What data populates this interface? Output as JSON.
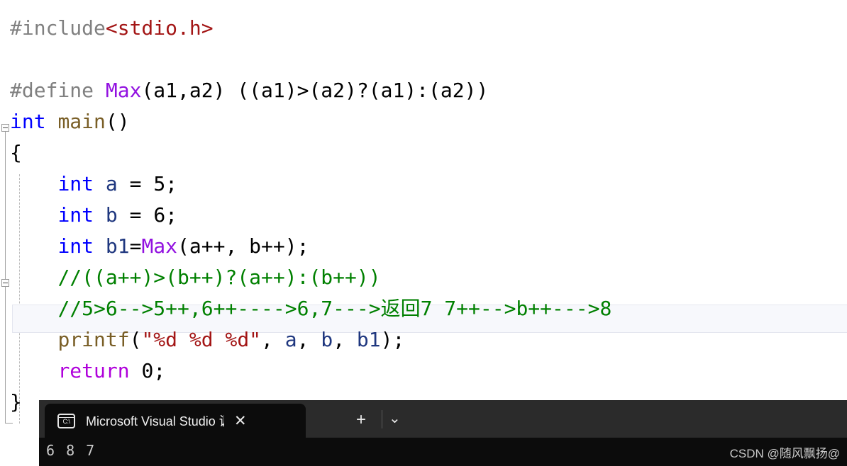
{
  "editor": {
    "lines": [
      {
        "id": "line-include",
        "tokens": [
          {
            "cls": "t-pre",
            "text": "#include"
          },
          {
            "cls": "t-string",
            "text": "<stdio.h>"
          }
        ]
      },
      {
        "id": "line-blank-1",
        "tokens": [
          {
            "cls": "t-plain",
            "text": " "
          }
        ]
      },
      {
        "id": "line-define",
        "tokens": [
          {
            "cls": "t-pre",
            "text": "#define "
          },
          {
            "cls": "t-macro",
            "text": "Max"
          },
          {
            "cls": "t-plain",
            "text": "(a1,a2) ((a1)>(a2)?(a1):(a2))"
          }
        ]
      },
      {
        "id": "line-main",
        "tokens": [
          {
            "cls": "t-kw",
            "text": "int "
          },
          {
            "cls": "t-func",
            "text": "main"
          },
          {
            "cls": "t-plain",
            "text": "()"
          }
        ]
      },
      {
        "id": "line-open-brace",
        "tokens": [
          {
            "cls": "t-plain",
            "text": "{"
          }
        ]
      },
      {
        "id": "line-int-a",
        "tokens": [
          {
            "cls": "t-plain",
            "text": "    "
          },
          {
            "cls": "t-kw",
            "text": "int"
          },
          {
            "cls": "t-plain",
            "text": " "
          },
          {
            "cls": "t-var",
            "text": "a"
          },
          {
            "cls": "t-plain",
            "text": " = "
          },
          {
            "cls": "t-num",
            "text": "5"
          },
          {
            "cls": "t-plain",
            "text": ";"
          }
        ]
      },
      {
        "id": "line-int-b",
        "tokens": [
          {
            "cls": "t-plain",
            "text": "    "
          },
          {
            "cls": "t-kw",
            "text": "int"
          },
          {
            "cls": "t-plain",
            "text": " "
          },
          {
            "cls": "t-var",
            "text": "b"
          },
          {
            "cls": "t-plain",
            "text": " = "
          },
          {
            "cls": "t-num",
            "text": "6"
          },
          {
            "cls": "t-plain",
            "text": ";"
          }
        ]
      },
      {
        "id": "line-int-b1",
        "tokens": [
          {
            "cls": "t-plain",
            "text": "    "
          },
          {
            "cls": "t-kw",
            "text": "int"
          },
          {
            "cls": "t-plain",
            "text": " "
          },
          {
            "cls": "t-var",
            "text": "b1"
          },
          {
            "cls": "t-plain",
            "text": "="
          },
          {
            "cls": "t-macro",
            "text": "Max"
          },
          {
            "cls": "t-plain",
            "text": "(a++, b++);"
          }
        ]
      },
      {
        "id": "line-comment-1",
        "tokens": [
          {
            "cls": "t-plain",
            "text": "    "
          },
          {
            "cls": "t-comment",
            "text": "//((a++)>(b++)?(a++):(b++))"
          }
        ]
      },
      {
        "id": "line-comment-2",
        "tokens": [
          {
            "cls": "t-plain",
            "text": "    "
          },
          {
            "cls": "t-comment",
            "text": "//5>6-->5++,6++---->6,7--->返回7 7++-->b++--->8"
          }
        ]
      },
      {
        "id": "line-printf",
        "tokens": [
          {
            "cls": "t-plain",
            "text": "    "
          },
          {
            "cls": "t-func",
            "text": "printf"
          },
          {
            "cls": "t-plain",
            "text": "("
          },
          {
            "cls": "t-string",
            "text": "\"%d %d %d\""
          },
          {
            "cls": "t-plain",
            "text": ", "
          },
          {
            "cls": "t-var",
            "text": "a"
          },
          {
            "cls": "t-plain",
            "text": ", "
          },
          {
            "cls": "t-var",
            "text": "b"
          },
          {
            "cls": "t-plain",
            "text": ", "
          },
          {
            "cls": "t-var",
            "text": "b1"
          },
          {
            "cls": "t-plain",
            "text": ");"
          }
        ]
      },
      {
        "id": "line-return",
        "tokens": [
          {
            "cls": "t-plain",
            "text": "    "
          },
          {
            "cls": "t-kwctl",
            "text": "return"
          },
          {
            "cls": "t-plain",
            "text": " "
          },
          {
            "cls": "t-num",
            "text": "0"
          },
          {
            "cls": "t-plain",
            "text": ";"
          }
        ]
      },
      {
        "id": "line-close-brace",
        "tokens": [
          {
            "cls": "t-plain",
            "text": "}"
          }
        ]
      }
    ],
    "fold_main_state": "expanded",
    "fold_comment_state": "expanded",
    "current_line_index": 9,
    "colors": {
      "preprocessor": "#808080",
      "string": "#a31515",
      "keyword": "#0000ff",
      "control_keyword": "#af00db",
      "macro": "#9211e0",
      "function": "#795e26",
      "variable": "#1f377f",
      "comment": "#008000",
      "current_line_bg": "#f7f8fc"
    }
  },
  "terminal": {
    "tab": {
      "icon": "command-prompt-icon",
      "icon_text": "C:\\",
      "title": "Microsoft Visual Studio 调试控制台",
      "close_label": "✕"
    },
    "new_tab_label": "+",
    "dropdown_label": "⌄",
    "output": "6 8 7",
    "background": "#0c0c0c",
    "tabstrip_background": "#2b2b2b"
  },
  "watermark": {
    "text": "CSDN @随风飘扬@"
  }
}
